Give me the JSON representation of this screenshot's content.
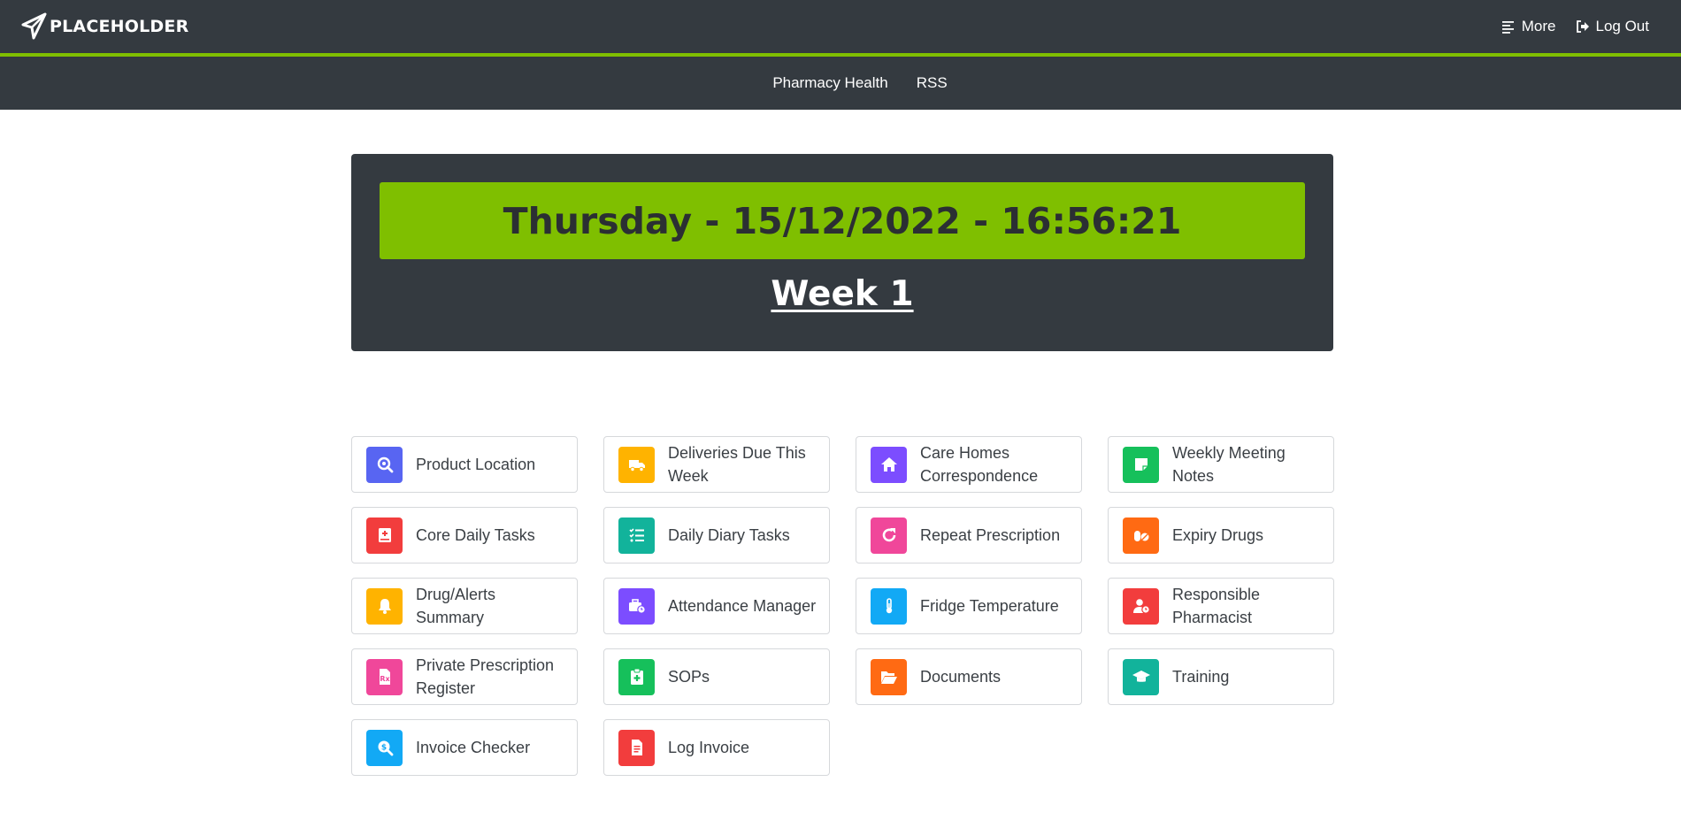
{
  "header": {
    "brand": "PLACEHOLDER",
    "more_label": "More",
    "logout_label": "Log Out"
  },
  "subnav": {
    "items": [
      "Pharmacy Health",
      "RSS"
    ]
  },
  "datetime": {
    "text": "Thursday - 15/12/2022 - 16:56:21",
    "week": "Week 1"
  },
  "colors": {
    "navbar": "#343a40",
    "accent": "#7fbf00"
  },
  "tiles": [
    {
      "label": "Product Location",
      "icon": "search-location-icon",
      "color": "#5865f2"
    },
    {
      "label": "Deliveries Due This Week",
      "icon": "truck-icon",
      "color": "#ffb300"
    },
    {
      "label": "Care Homes Correspondence",
      "icon": "home-icon",
      "color": "#7c4dff"
    },
    {
      "label": "Weekly Meeting Notes",
      "icon": "sticky-note-icon",
      "color": "#16c05b"
    },
    {
      "label": "Core Daily Tasks",
      "icon": "medical-book-icon",
      "color": "#f23d3d"
    },
    {
      "label": "Daily Diary Tasks",
      "icon": "checklist-icon",
      "color": "#12b39b"
    },
    {
      "label": "Repeat Prescription",
      "icon": "redo-icon",
      "color": "#f0479a"
    },
    {
      "label": "Expiry Drugs",
      "icon": "pills-icon",
      "color": "#ff6a13"
    },
    {
      "label": "Drug/Alerts Summary",
      "icon": "bell-icon",
      "color": "#ffb300"
    },
    {
      "label": "Attendance Manager",
      "icon": "briefcase-clock-icon",
      "color": "#7c4dff"
    },
    {
      "label": "Fridge Temperature",
      "icon": "thermometer-icon",
      "color": "#12a9f5"
    },
    {
      "label": "Responsible Pharmacist",
      "icon": "user-clock-icon",
      "color": "#f23d3d"
    },
    {
      "label": "Private Prescription Register",
      "icon": "prescription-icon",
      "color": "#f0479a"
    },
    {
      "label": "SOPs",
      "icon": "clipboard-medical-icon",
      "color": "#16c05b"
    },
    {
      "label": "Documents",
      "icon": "folder-open-icon",
      "color": "#ff6a13"
    },
    {
      "label": "Training",
      "icon": "graduation-cap-icon",
      "color": "#12b39b"
    },
    {
      "label": "Invoice Checker",
      "icon": "search-dollar-icon",
      "color": "#12a9f5"
    },
    {
      "label": "Log Invoice",
      "icon": "invoice-icon",
      "color": "#f23d3d"
    }
  ]
}
